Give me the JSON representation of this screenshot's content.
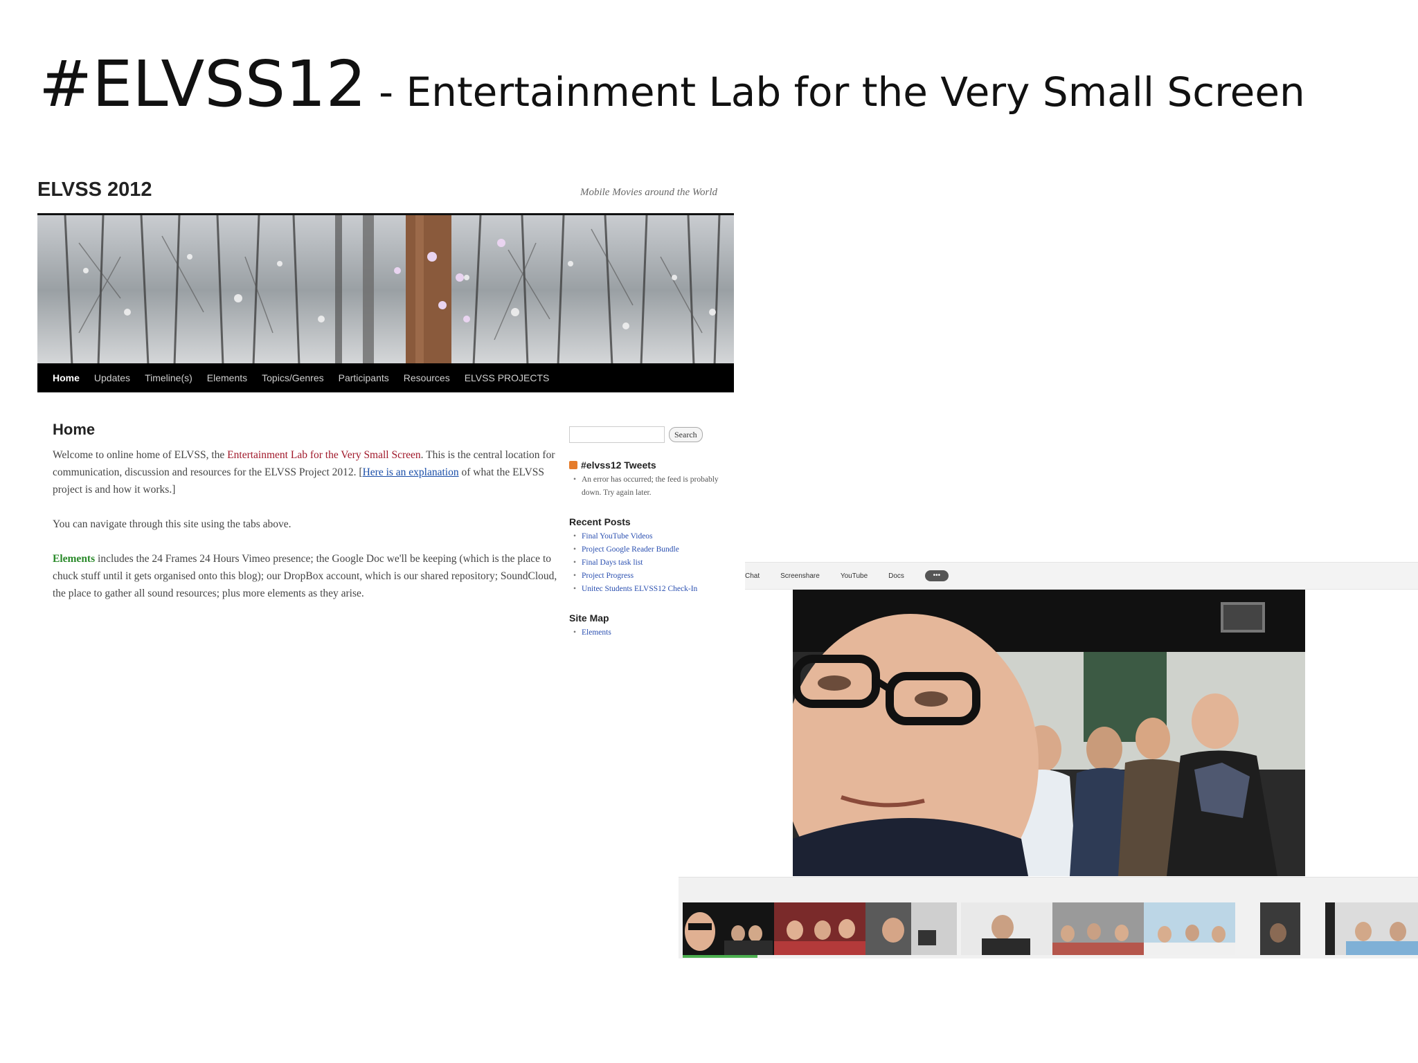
{
  "slide": {
    "title": "#ELVSS12",
    "subtitle": "- Entertainment Lab for the Very Small Screen"
  },
  "website": {
    "site_title": "ELVSS 2012",
    "tagline": "Mobile Movies around the World",
    "nav": [
      "Home",
      "Updates",
      "Timeline(s)",
      "Elements",
      "Topics/Genres",
      "Participants",
      "Resources",
      "ELVSS PROJECTS"
    ],
    "nav_active": "Home",
    "main": {
      "heading": "Home",
      "p1_a": "Welcome to online home of ELVSS, the ",
      "p1_link": "Entertainment Lab for the Very Small Screen",
      "p1_b": ". This is the central location for communication, discussion and resources for the ELVSS Project 2012.",
      "p1_link2": "Here is an explanation",
      "p1_c": " of what the ELVSS project is and how it works.]",
      "p1_bracket": " [",
      "p2": "You can navigate through this site using the tabs above.",
      "p3_link": "Elements",
      "p3": " includes the 24 Frames 24 Hours Vimeo presence; the Google Doc we'll be keeping (which is the place to chuck stuff until it gets organised onto this blog); our DropBox account, which is our shared repository; SoundCloud, the place to gather all sound resources; plus more elements as they arise."
    },
    "sidebar": {
      "search_button": "Search",
      "tweets_title": "#elvss12 Tweets",
      "tweets_error": "An error has occurred; the feed is probably down. Try again later.",
      "recent_title": "Recent Posts",
      "recent_posts": [
        "Final YouTube Videos",
        "Project Google Reader Bundle",
        "Final Days task list",
        "Project Progress",
        "Unitec Students ELVSS12 Check-In"
      ],
      "sitemap_title": "Site Map",
      "sitemap_items": [
        "Elements"
      ]
    }
  },
  "video_call": {
    "toolbar": [
      "Chat",
      "Screenshare",
      "YouTube",
      "Docs"
    ],
    "more_icon": "more-options-icon"
  }
}
